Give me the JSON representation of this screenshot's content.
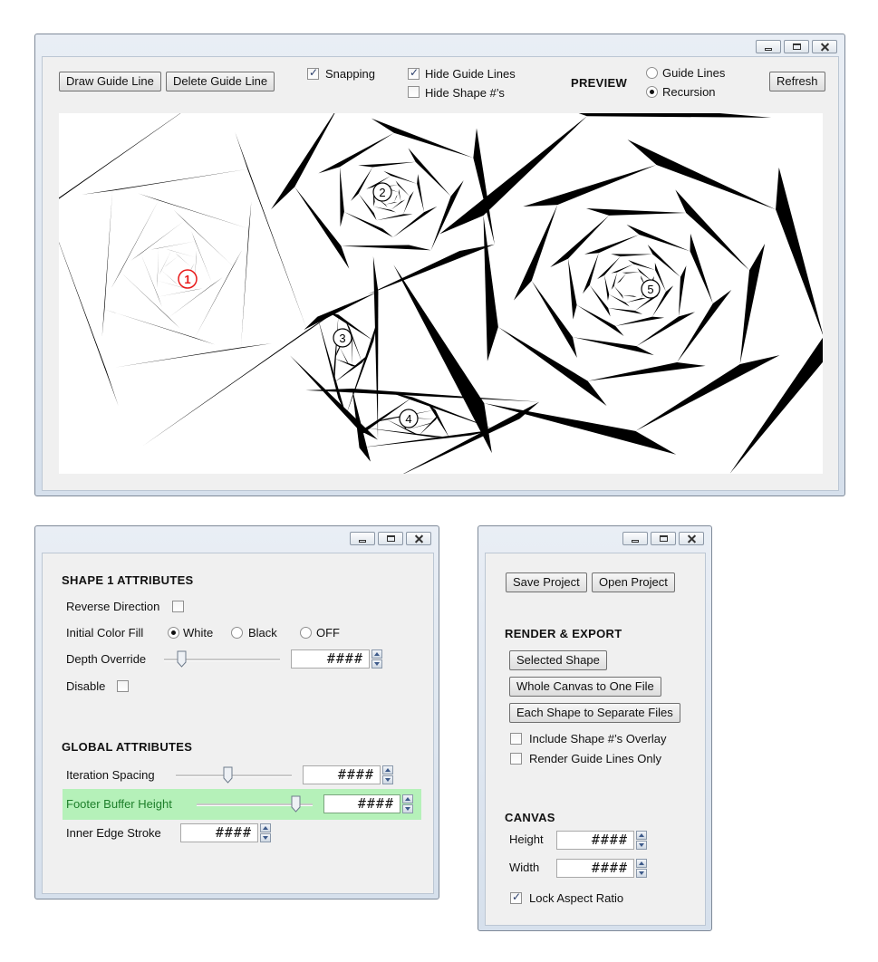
{
  "main_window": {
    "buttons": {
      "draw_guide_line": "Draw Guide Line",
      "delete_guide_line": "Delete Guide Line",
      "refresh": "Refresh"
    },
    "snapping": {
      "label": "Snapping",
      "checked": true
    },
    "hide_guide_lines": {
      "label": "Hide Guide Lines",
      "checked": true
    },
    "hide_shape_numbers": {
      "label": "Hide Shape #’s",
      "checked": false
    },
    "preview": {
      "label": "PREVIEW",
      "options": [
        "Guide Lines",
        "Recursion"
      ],
      "selected": "Recursion"
    },
    "canvas": {
      "shape_numbers": [
        "1",
        "2",
        "3",
        "4",
        "5"
      ],
      "selected_shape": "1",
      "selected_color": "#e81a1a"
    }
  },
  "shape_window": {
    "shape_title": "SHAPE 1 ATTRIBUTES",
    "reverse_direction": {
      "label": "Reverse Direction",
      "checked": false
    },
    "initial_color_fill": {
      "label": "Initial Color Fill",
      "options": [
        "White",
        "Black",
        "OFF"
      ],
      "selected": "White"
    },
    "depth_override": {
      "label": "Depth Override",
      "value": "####"
    },
    "disable": {
      "label": "Disable",
      "checked": false
    },
    "global_title": "GLOBAL ATTRIBUTES",
    "iteration_spacing": {
      "label": "Iteration Spacing",
      "value": "####"
    },
    "footer_buffer_height": {
      "label": "Footer Buffer Height",
      "value": "####",
      "highlight_color": "#b5f1b9",
      "label_color": "#1d7f2a"
    },
    "inner_edge_stroke": {
      "label": "Inner Edge Stroke",
      "value": "####"
    }
  },
  "project_window": {
    "save_project": "Save Project",
    "open_project": "Open Project",
    "render_title": "RENDER & EXPORT",
    "selected_shape": "Selected Shape",
    "whole_canvas": "Whole Canvas to One File",
    "each_shape": "Each Shape to Separate Files",
    "include_overlay": {
      "label": "Include Shape #’s Overlay",
      "checked": false
    },
    "render_guides_only": {
      "label": "Render Guide Lines Only",
      "checked": false
    },
    "canvas_title": "CANVAS",
    "height": {
      "label": "Height",
      "value": "####"
    },
    "width": {
      "label": "Width",
      "value": "####"
    },
    "lock_aspect": {
      "label": "Lock Aspect Ratio",
      "checked": true
    }
  }
}
